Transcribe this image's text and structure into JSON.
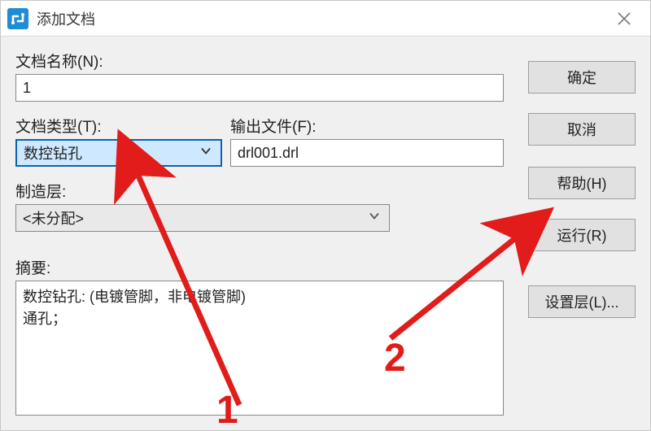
{
  "window": {
    "title": "添加文档"
  },
  "labels": {
    "doc_name": "文档名称(N):",
    "doc_type": "文档类型(T):",
    "output_file": "输出文件(F):",
    "mfg_layer": "制造层:",
    "summary": "摘要:"
  },
  "fields": {
    "doc_name_value": "1",
    "doc_type_value": "数控钻孔",
    "output_file_value": "drl001.drl",
    "mfg_layer_value": "<未分配>",
    "summary_value": "数控钻孔: (电镀管脚，非电镀管脚)\n通孔；"
  },
  "buttons": {
    "ok": "确定",
    "cancel": "取消",
    "help": "帮助(H)",
    "run": "运行(R)",
    "set_layers": "设置层(L)..."
  },
  "annotations": {
    "num1": "1",
    "num2": "2",
    "arrow_color": "#e21b1b"
  }
}
